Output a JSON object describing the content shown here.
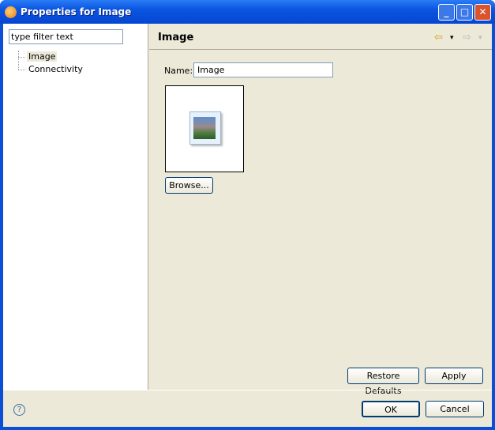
{
  "window": {
    "title": "Properties for Image",
    "minimize": "_",
    "maximize": "□",
    "close": "✕"
  },
  "filter": {
    "placeholder": "type filter text"
  },
  "tree": [
    {
      "label": "Image"
    },
    {
      "label": "Connectivity"
    }
  ],
  "page": {
    "title": "Image",
    "back": "⇦",
    "forward": "⇨",
    "dropdown": "▾"
  },
  "form": {
    "name_label": "Name:",
    "name_value": "Image",
    "browse": "Browse..."
  },
  "buttons": {
    "restore": "Restore Defaults",
    "apply": "Apply",
    "ok": "OK",
    "cancel": "Cancel",
    "help": "?"
  }
}
